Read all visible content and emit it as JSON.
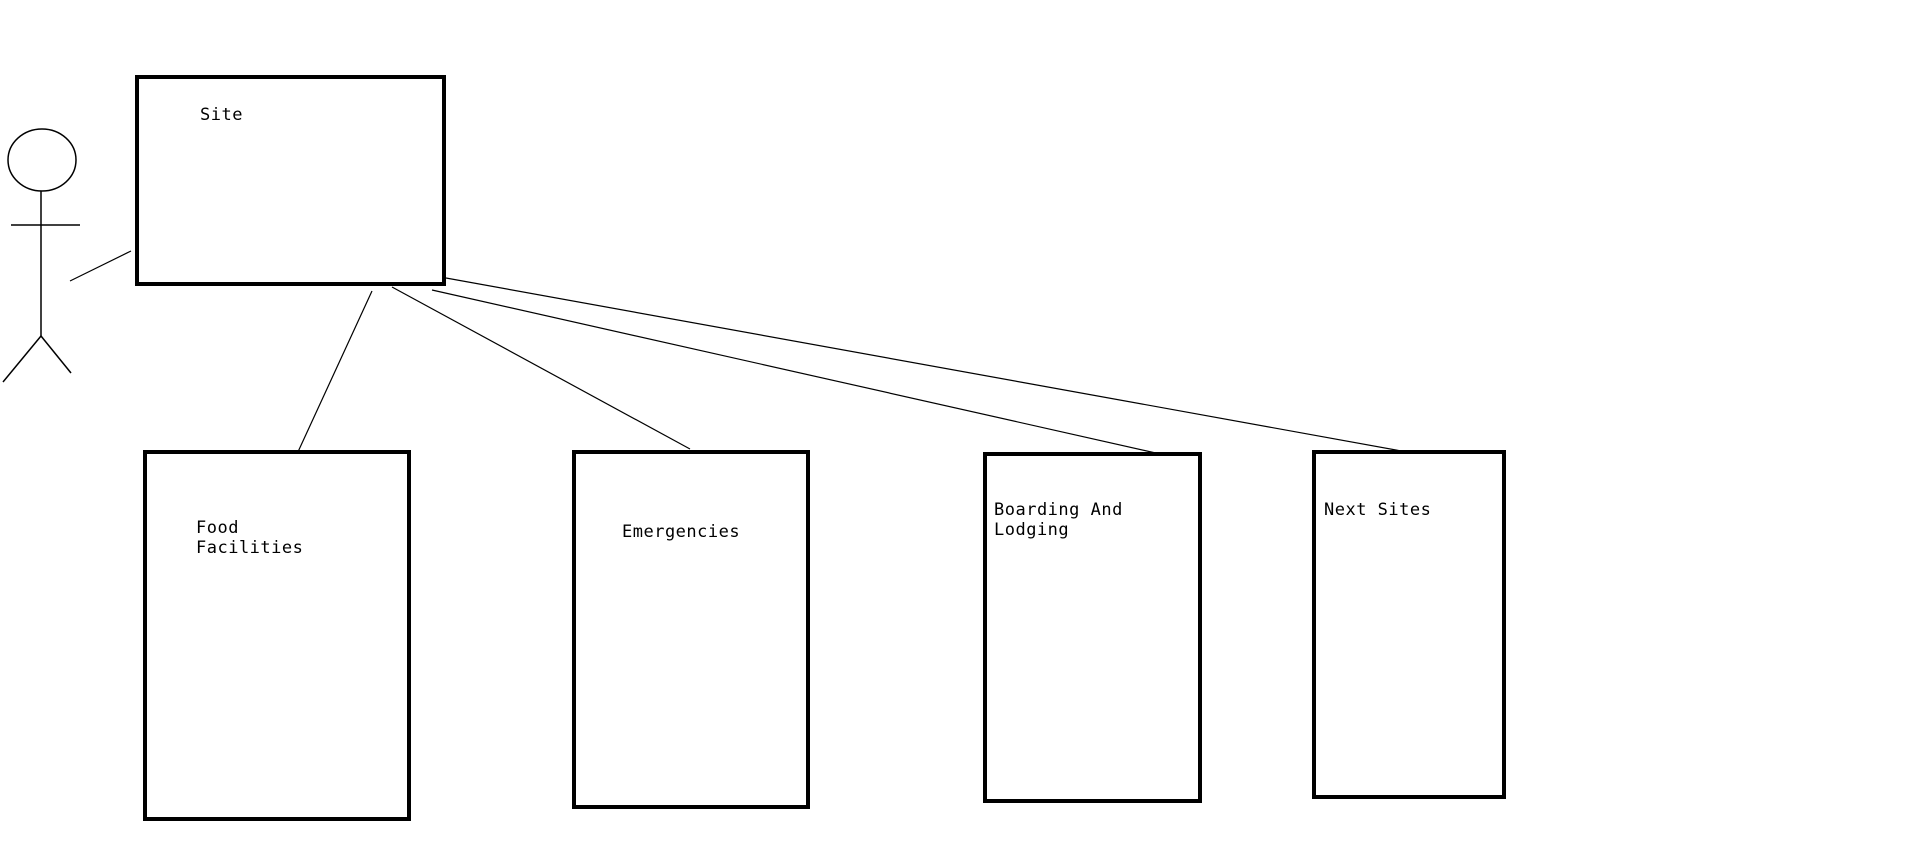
{
  "diagram": {
    "actor": {
      "icon": "stick-figure-actor-icon"
    },
    "root": {
      "id": "site",
      "label": "Site"
    },
    "children": [
      {
        "id": "food",
        "label": "Food\nFacilities"
      },
      {
        "id": "emergencies",
        "label": "Emergencies"
      },
      {
        "id": "boarding",
        "label": "Boarding And\nLodging"
      },
      {
        "id": "next",
        "label": "Next Sites"
      }
    ],
    "connections": [
      {
        "from": "actor",
        "to": "site"
      },
      {
        "from": "site",
        "to": "food"
      },
      {
        "from": "site",
        "to": "emergencies"
      },
      {
        "from": "site",
        "to": "boarding"
      },
      {
        "from": "site",
        "to": "next"
      }
    ],
    "colors": {
      "stroke": "#000000",
      "background": "#ffffff"
    }
  }
}
